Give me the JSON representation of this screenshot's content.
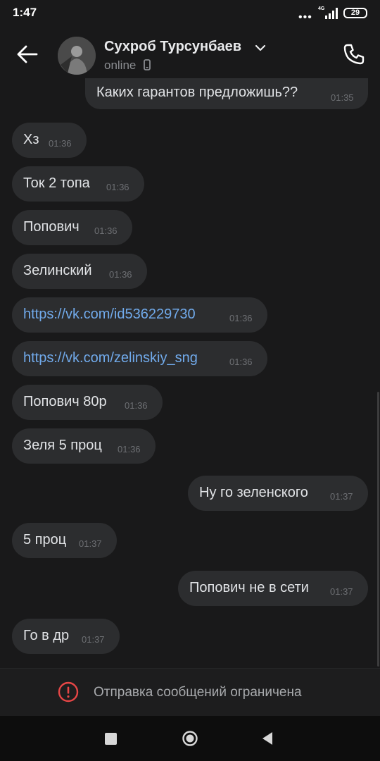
{
  "status_bar": {
    "time": "1:47",
    "dots": "•••",
    "network": "4G",
    "battery": "29"
  },
  "header": {
    "contact_name": "Сухроб Турсунбаев",
    "status": "online"
  },
  "messages": [
    {
      "text": "Каких гарантов предложишь??",
      "time": "01:35",
      "outgoing": true
    },
    {
      "text": "Хз",
      "time": "01:36",
      "outgoing": false
    },
    {
      "text": "Ток 2 топа",
      "time": "01:36",
      "outgoing": false
    },
    {
      "text": "Попович",
      "time": "01:36",
      "outgoing": false
    },
    {
      "text": "Зелинский",
      "time": "01:36",
      "outgoing": false
    },
    {
      "text": "https://vk.com/id536229730",
      "time": "01:36",
      "outgoing": false,
      "link": true
    },
    {
      "text": "https://vk.com/zelinskiy_sng",
      "time": "01:36",
      "outgoing": false,
      "link": true
    },
    {
      "text": "Попович 80р",
      "time": "01:36",
      "outgoing": false
    },
    {
      "text": "Зеля 5 проц",
      "time": "01:36",
      "outgoing": false
    },
    {
      "text": "Ну го зеленского",
      "time": "01:37",
      "outgoing": true
    },
    {
      "text": "5 проц",
      "time": "01:37",
      "outgoing": false
    },
    {
      "text": "Попович не в сети",
      "time": "01:37",
      "outgoing": true
    },
    {
      "text": "Го в др",
      "time": "01:37",
      "outgoing": false
    }
  ],
  "restriction": {
    "text": "Отправка сообщений ограничена"
  },
  "icons": {
    "back": "arrow-left-icon",
    "phone": "phone-icon",
    "mobile": "mobile-device-icon",
    "chevron": "chevron-down-icon",
    "warning": "exclamation-circle-icon"
  },
  "colors": {
    "background": "#19191a",
    "bubble": "#2c2d2f",
    "link": "#71aaeb",
    "warning": "#e64646"
  }
}
